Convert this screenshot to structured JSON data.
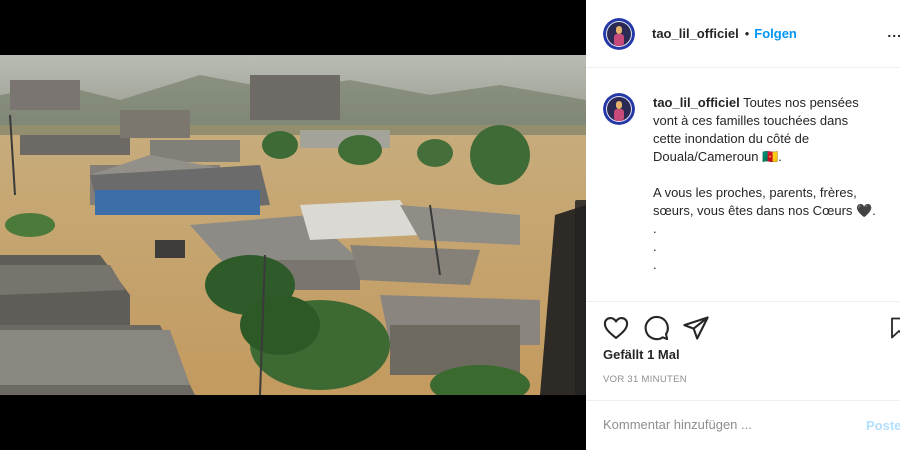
{
  "post": {
    "username": "tao_lil_officiel",
    "header_separator": "•",
    "follow_label": "Folgen",
    "more_label": "...",
    "caption": {
      "username": "tao_lil_officiel",
      "line1": "Toutes nos pensées",
      "line2": "vont à ces familles touchées dans",
      "line3": "cette inondation du côté de",
      "line4": "Douala/Cameroun 🇨🇲.",
      "line5": "A vous les proches, parents, frères,",
      "line6": "sœurs, vous êtes dans nos Cœurs 🖤.",
      "dot1": ".",
      "dot2": ".",
      "dot3": "."
    },
    "likes_text": "Gefällt 1 Mal",
    "timestamp": "VOR 31 MINUTEN",
    "comment_placeholder": "Kommentar hinzufügen ...",
    "post_label": "Posten"
  },
  "icons": {
    "like": "heart-icon",
    "comment": "comment-icon",
    "share": "paper-plane-icon",
    "save": "bookmark-icon"
  },
  "colors": {
    "accent": "#0095f6",
    "text": "#262626",
    "muted": "#8e8e8e",
    "post_disabled": "#b2dffc",
    "flood_water": "#c9a36a"
  }
}
